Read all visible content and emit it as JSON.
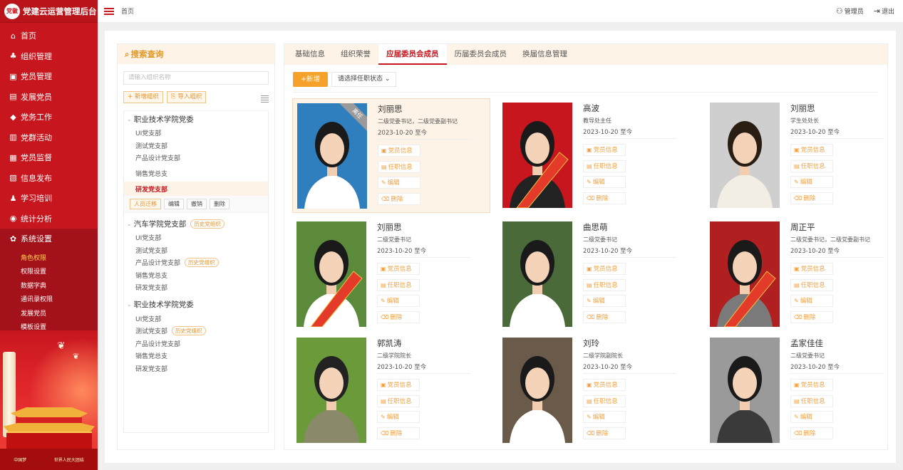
{
  "app": {
    "logo_text": "党徽",
    "title": "党建云运营管理后台"
  },
  "topbar": {
    "breadcrumb": "首页",
    "admin_label": "管理员",
    "logout_label": "退出"
  },
  "sidebar": {
    "items": [
      {
        "label": "首页",
        "icon": "home-icon",
        "glyph": "⌂"
      },
      {
        "label": "组织管理",
        "icon": "org-icon",
        "glyph": "♣"
      },
      {
        "label": "党员管理",
        "icon": "member-icon",
        "glyph": "▣"
      },
      {
        "label": "发展党员",
        "icon": "develop-icon",
        "glyph": "▤"
      },
      {
        "label": "党务工作",
        "icon": "work-icon",
        "glyph": "◆"
      },
      {
        "label": "党群活动",
        "icon": "activity-icon",
        "glyph": "▥"
      },
      {
        "label": "党员监督",
        "icon": "supervise-icon",
        "glyph": "▦"
      },
      {
        "label": "信息发布",
        "icon": "publish-icon",
        "glyph": "▧"
      },
      {
        "label": "学习培训",
        "icon": "study-icon",
        "glyph": "♟"
      },
      {
        "label": "统计分析",
        "icon": "stats-icon",
        "glyph": "◉"
      },
      {
        "label": "系统设置",
        "icon": "settings-icon",
        "glyph": "✿"
      }
    ],
    "sub_items": [
      "角色权限",
      "权限设置",
      "数据字典",
      "通讯录权限",
      "发展党员",
      "模板设置"
    ],
    "banner_left": "中国梦",
    "banner_right": "世界人民大团结"
  },
  "search": {
    "title": "搜索查询",
    "placeholder": "请输入组织名称",
    "add_org": "+ 新增组织",
    "import_org": "导入组织"
  },
  "tree": {
    "group1": {
      "name": "职业技术学院党委",
      "children": [
        "UI党支部",
        "测试党支部",
        "产品设计党支部",
        "销售党总支"
      ],
      "selected": "研发党支部"
    },
    "actions": [
      "人员迁移",
      "编辑",
      "撤销",
      "删除"
    ],
    "group2": {
      "name": "汽车学院党支部",
      "tag": "历史党组织",
      "children": [
        {
          "name": "UI党支部",
          "tag": ""
        },
        {
          "name": "测试党支部",
          "tag": ""
        },
        {
          "name": "产品设计党支部",
          "tag": "历史党组织"
        },
        {
          "name": "销售党总支",
          "tag": ""
        },
        {
          "name": "研发党支部",
          "tag": ""
        }
      ]
    },
    "group3": {
      "name": "职业技术学院党委",
      "children": [
        {
          "name": "UI党支部",
          "tag": ""
        },
        {
          "name": "测试党支部",
          "tag": "历史党组织"
        },
        {
          "name": "产品设计党支部",
          "tag": ""
        },
        {
          "name": "销售党总支",
          "tag": ""
        },
        {
          "name": "研发党支部",
          "tag": ""
        }
      ]
    }
  },
  "tabs": [
    "基础信息",
    "组织荣誉",
    "应届委员会成员",
    "历届委员会成员",
    "换届信息管理"
  ],
  "active_tab": "应届委员会成员",
  "toolbar": {
    "add_label": "+新增",
    "status_placeholder": "请选择任职状态"
  },
  "action_labels": {
    "info": "党员信息",
    "duty": "任职信息",
    "edit": "编辑",
    "delete": "删除"
  },
  "ribbon_label": "离任",
  "members": [
    {
      "name": "刘丽思",
      "position": "二级党委书记，二级党委副书记",
      "date": "2023-10-20 至今",
      "badge": "离任",
      "bg": "#2f7fbf",
      "shirt": "#ffffff",
      "sash": false,
      "hair": "#1a1a1a"
    },
    {
      "name": "高波",
      "position": "教导处主任",
      "date": "2023-10-20 至今",
      "badge": "",
      "bg": "#c8161e",
      "shirt": "#222222",
      "sash": true,
      "hair": "#1a1a1a"
    },
    {
      "name": "刘丽思",
      "position": "学生处处长",
      "date": "2023-10-20 至今",
      "badge": "",
      "bg": "#cfcfcf",
      "shirt": "#f3eee4",
      "sash": false,
      "hair": "#2a1d12"
    },
    {
      "name": "刘丽思",
      "position": "二级党委书记",
      "date": "2023-10-20 至今",
      "badge": "",
      "bg": "#5a8a3a",
      "shirt": "#ffffff",
      "sash": true,
      "hair": "#1a1a1a"
    },
    {
      "name": "曲思萌",
      "position": "二级党委书记",
      "date": "2023-10-20 至今",
      "badge": "",
      "bg": "#4a6a3a",
      "shirt": "#ffffff",
      "sash": false,
      "hair": "#1a1a1a"
    },
    {
      "name": "周正平",
      "position": "二级党委书记，二级党委副书记",
      "date": "2023-10-20 至今",
      "badge": "",
      "bg": "#b02020",
      "shirt": "#7a7a7a",
      "sash": true,
      "hair": "#1a1a1a"
    },
    {
      "name": "郭凯涛",
      "position": "二级学院院长",
      "date": "2023-10-20 至今",
      "badge": "",
      "bg": "#6a9a3a",
      "shirt": "#8a8a6a",
      "sash": false,
      "hair": "#222222"
    },
    {
      "name": "刘玲",
      "position": "二级学院副院长",
      "date": "2023-10-20 至今",
      "badge": "",
      "bg": "#6a5a4a",
      "shirt": "#ffffff",
      "sash": false,
      "hair": "#1a1a1a"
    },
    {
      "name": "孟家佳佳",
      "position": "二级党委书记",
      "date": "2023-10-20 至今",
      "badge": "",
      "bg": "#9a9a9a",
      "shirt": "#3a3a3a",
      "sash": false,
      "hair": "#1a1a1a"
    }
  ]
}
